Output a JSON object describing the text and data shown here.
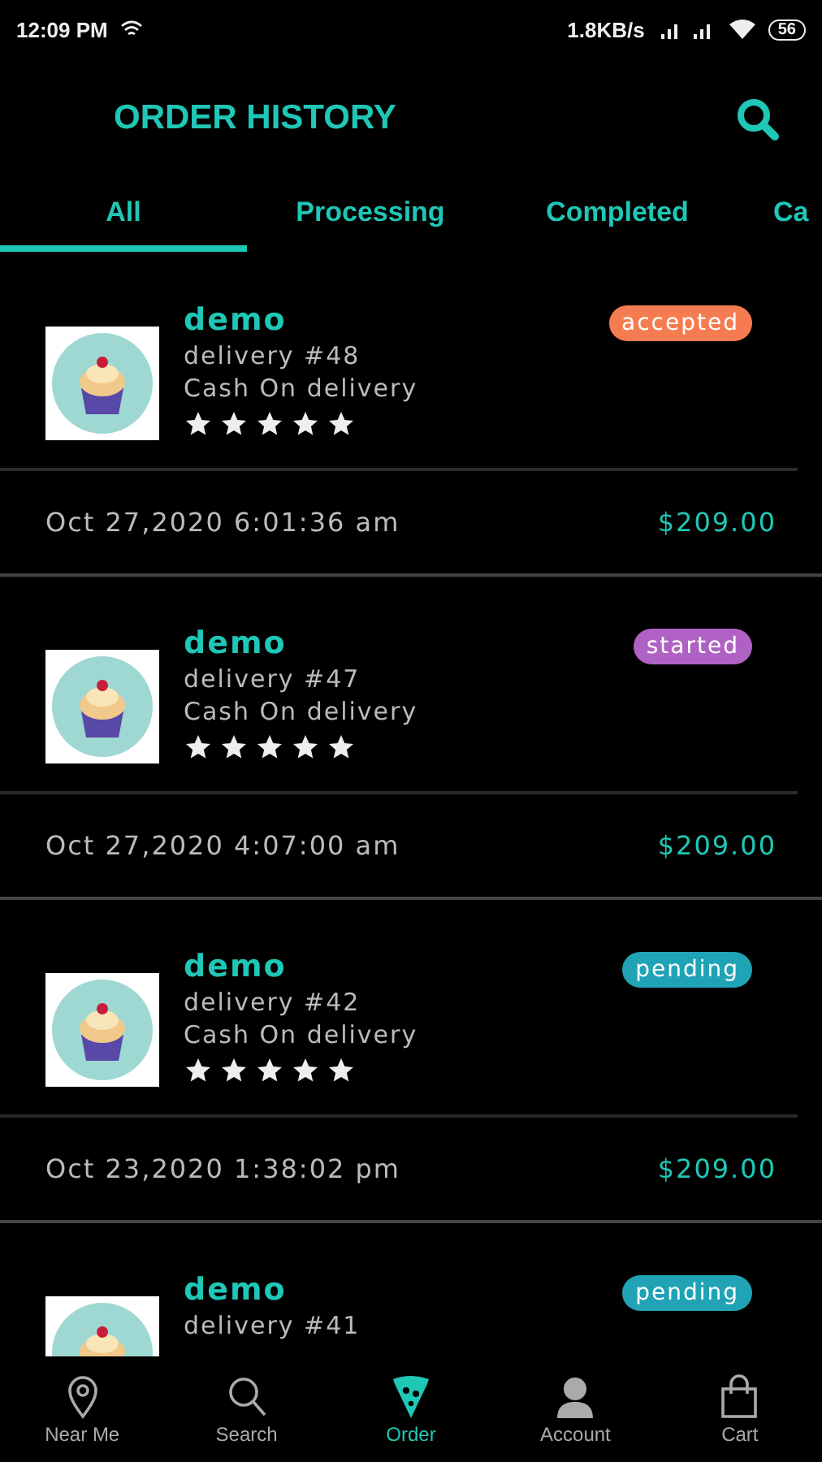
{
  "status_bar": {
    "time": "12:09 PM",
    "speed": "1.8KB/s",
    "battery": "56"
  },
  "header": {
    "title": "ORDER HISTORY"
  },
  "tabs": [
    {
      "label": "All",
      "selected": true
    },
    {
      "label": "Processing",
      "selected": false
    },
    {
      "label": "Completed",
      "selected": false
    },
    {
      "label": "Ca",
      "selected": false
    }
  ],
  "orders": [
    {
      "name": "demo",
      "delivery": "delivery #48",
      "payment": "Cash On delivery",
      "stars": 5,
      "status": "accepted",
      "color": "#f47c50",
      "date": "Oct 27,2020 6:01:36 am",
      "total": "$209.00"
    },
    {
      "name": "demo",
      "delivery": "delivery #47",
      "payment": "Cash On delivery",
      "stars": 5,
      "status": "started",
      "color": "#b062c4",
      "date": "Oct 27,2020 4:07:00 am",
      "total": "$209.00"
    },
    {
      "name": "demo",
      "delivery": "delivery #42",
      "payment": "Cash On delivery",
      "stars": 5,
      "status": "pending",
      "color": "#1fa3b5",
      "date": "Oct 23,2020 1:38:02 pm",
      "total": "$209.00"
    },
    {
      "name": "demo",
      "delivery": "delivery #41",
      "status": "pending",
      "color": "#1fa3b5"
    }
  ],
  "nav": [
    {
      "label": "Near Me",
      "kind": "pin",
      "selected": false
    },
    {
      "label": "Search",
      "kind": "search",
      "selected": false
    },
    {
      "label": "Order",
      "kind": "pizza",
      "selected": true
    },
    {
      "label": "Account",
      "kind": "person",
      "selected": false
    },
    {
      "label": "Cart",
      "kind": "bag",
      "selected": false
    }
  ]
}
